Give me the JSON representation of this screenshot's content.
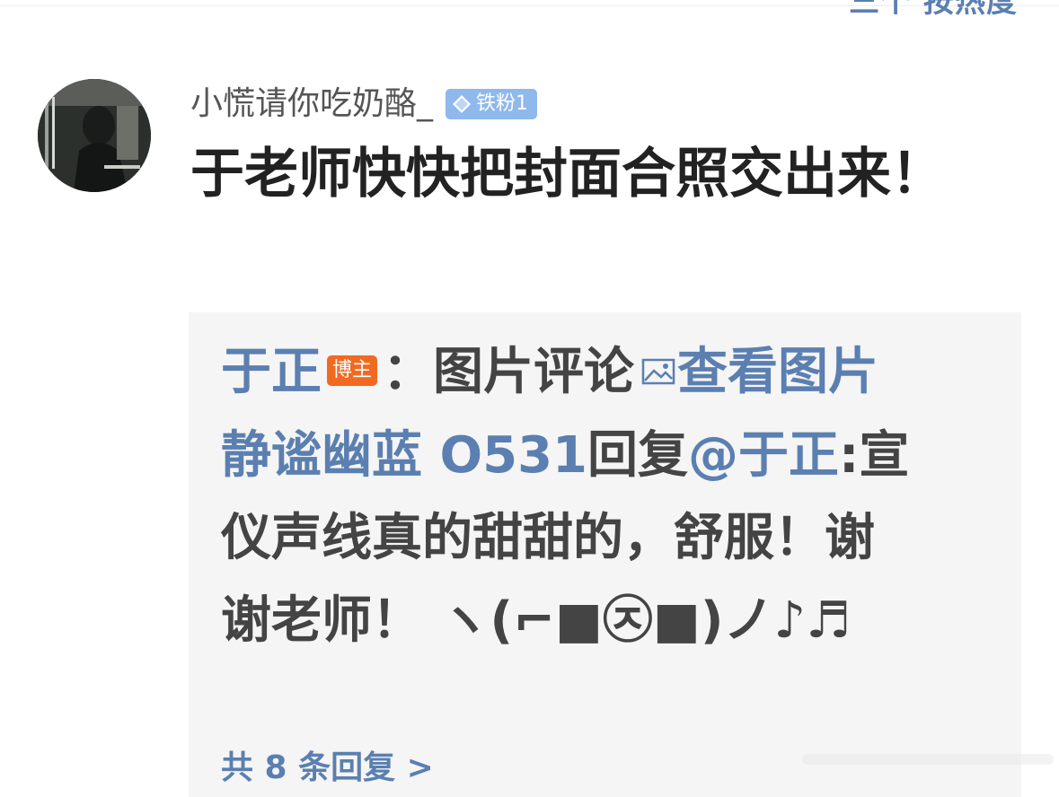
{
  "header": {
    "sort_label": "三个 按热度"
  },
  "comment": {
    "username": "小慌请你吃奶酪_",
    "fan_badge": "铁粉1",
    "text": "于老师快快把封面合照交出来！"
  },
  "reply_box": {
    "author": "于正",
    "author_badge": "博主",
    "image_comment_label": "：图片评论",
    "view_image_label": "查看图片",
    "reply_user": "静谧幽蓝 O531",
    "reply_verb": "回复",
    "mention": "@于正",
    "colon": ":",
    "reply_text": "宣仪声线真的甜甜的，舒服！谢谢老师！ ヽ(⌐■㉨■)ノ♪♬",
    "more_replies": "共 8 条回复 >"
  },
  "colors": {
    "link_blue": "#5b7fb0",
    "fan_badge_bg": "#8fb8ec",
    "blogger_badge_bg": "#f26a21",
    "reply_bg": "#f5f5f5"
  },
  "icons": {
    "fan_badge": "diamond-icon",
    "view_image": "image-icon"
  }
}
